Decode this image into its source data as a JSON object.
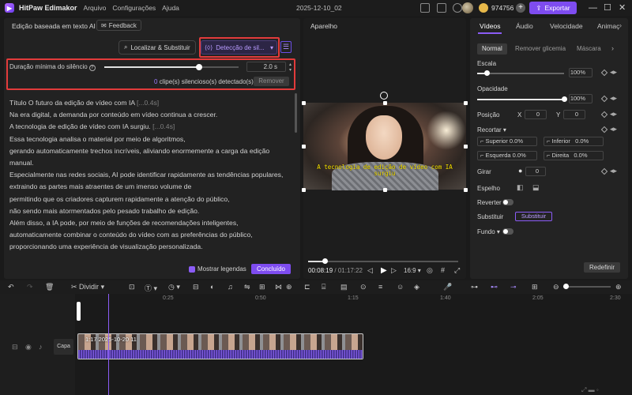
{
  "app": {
    "name": "HitPaw Edimakor",
    "document_title": "2025-12-10_02",
    "credits": "974756",
    "export_label": "Exportar"
  },
  "menu": [
    "Arquivo",
    "Configurações",
    "Ajuda"
  ],
  "left_panel": {
    "title": "Edição baseada em texto AI",
    "feedback_label": "Feedback",
    "find_replace_label": "Localizar & Substituir",
    "silence_detection_label": "Detecção de sil...",
    "min_silence_label": "Duração mínima do silêncio",
    "min_silence_value": "2.0 s",
    "detected_count": "0",
    "detected_text": "clipe(s) silencioso(s) detectado(s)",
    "remove_label": "Remover",
    "show_captions_label": "Mostrar legendas",
    "done_label": "Concluído",
    "transcript": [
      {
        "text": "Título O futuro da edição de vídeo com IA ",
        "marker": "[...0.4s]"
      },
      {
        "text": "Na era digital, a demanda por conteúdo em vídeo continua a crescer.",
        "marker": ""
      },
      {
        "text": "A tecnologia de edição de vídeo com IA surgiu. ",
        "marker": "[...0.4s]"
      },
      {
        "text": "Essa tecnologia analisa o material por meio de algoritmos,",
        "marker": ""
      },
      {
        "text": "gerando automaticamente trechos incríveis, aliviando enormemente a carga da edição manual.",
        "marker": ""
      },
      {
        "text": "Especialmente nas redes sociais, AI pode identificar rapidamente as tendências populares,",
        "marker": ""
      },
      {
        "text": "extraindo as partes mais atraentes de um imenso volume de",
        "marker": ""
      },
      {
        "text": "permitindo que os criadores capturem rapidamente a atenção do público,",
        "marker": ""
      },
      {
        "text": "não sendo mais atormentados pelo pesado trabalho de edição.",
        "marker": ""
      },
      {
        "text": "Além disso, a IA pode, por meio de funções de recomendações inteligentes,",
        "marker": ""
      },
      {
        "text": "automaticamente combinar o conteúdo do vídeo com as preferências do público,",
        "marker": ""
      },
      {
        "text": "proporcionando uma experiência de visualização personalizada.",
        "marker": ""
      }
    ]
  },
  "preview": {
    "title": "Aparelho",
    "subtitle_line1": "A tecnologia de edição de vídeo com IA",
    "subtitle_line2": "surgiu",
    "current_time": "00:08:19",
    "total_time": "/ 01:17:22",
    "aspect_ratio": "16:9",
    "progress": 0.11
  },
  "right_panel": {
    "tabs": [
      "Vídeos",
      "Áudio",
      "Velocidade",
      "Animaç"
    ],
    "subtabs": [
      "Normal",
      "Remover glicemia",
      "Máscara"
    ],
    "scale_label": "Escala",
    "scale_value": "100%",
    "scale_level": 0.11,
    "opacity_label": "Opacidade",
    "opacity_value": "100%",
    "opacity_level": 1.0,
    "position_label": "Posição",
    "x_label": "X",
    "x_value": "0",
    "y_label": "Y",
    "y_value": "0",
    "crop_label": "Recortar",
    "crop_top_label": "Superior",
    "crop_top": "0.0%",
    "crop_bottom_label": "Inferior",
    "crop_bottom": "0.0%",
    "crop_left_label": "Esquerda",
    "crop_left": "0.0%",
    "crop_right_label": "Direita",
    "crop_right": "0.0%",
    "rotate_label": "Girar",
    "rotate_value": "0",
    "mirror_label": "Espelho",
    "reverse_label": "Reverter",
    "replace_label": "Substituir",
    "replace_button": "Substituir",
    "background_label": "Fundo",
    "reset_label": "Redefinir"
  },
  "toolbar": {
    "split_label": "Dividir"
  },
  "timeline": {
    "ticks": [
      "0:25",
      "0:50",
      "1:15",
      "1:40",
      "2:05",
      "2:30"
    ],
    "track_label": "Capa",
    "clip_label": "1:17 2025-10-20 11"
  }
}
